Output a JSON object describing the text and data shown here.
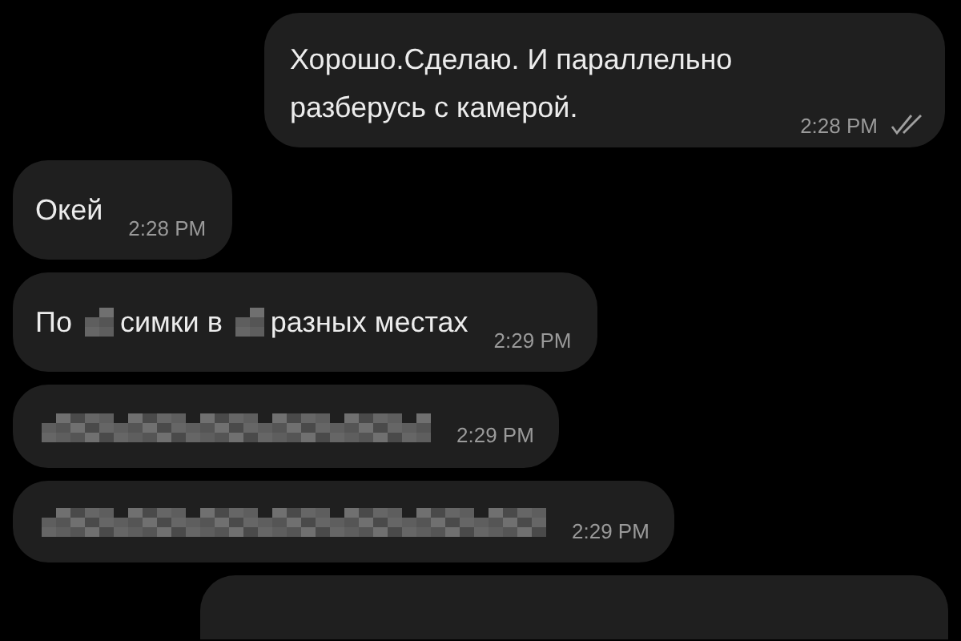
{
  "messages": [
    {
      "kind": "outgoing",
      "parts": [
        {
          "kind": "text",
          "text": "Хорошо.Сделаю. И параллельно разберусь с камерой."
        }
      ],
      "time": "2:28 PM",
      "read": true
    },
    {
      "kind": "incoming",
      "parts": [
        {
          "kind": "text",
          "text": "Окей"
        }
      ],
      "time": "2:28 PM"
    },
    {
      "kind": "incoming",
      "parts": [
        {
          "kind": "text",
          "text": "По"
        },
        {
          "kind": "blur-dot"
        },
        {
          "kind": "text",
          "text": "симки в"
        },
        {
          "kind": "blur-dot"
        },
        {
          "kind": "text",
          "text": "разных местах"
        }
      ],
      "time": "2:29 PM"
    },
    {
      "kind": "incoming",
      "parts": [
        {
          "kind": "blur-line"
        }
      ],
      "time": "2:29 PM"
    },
    {
      "kind": "incoming",
      "parts": [
        {
          "kind": "blur-wide"
        }
      ],
      "time": "2:29 PM"
    },
    {
      "kind": "outgoing"
    }
  ]
}
